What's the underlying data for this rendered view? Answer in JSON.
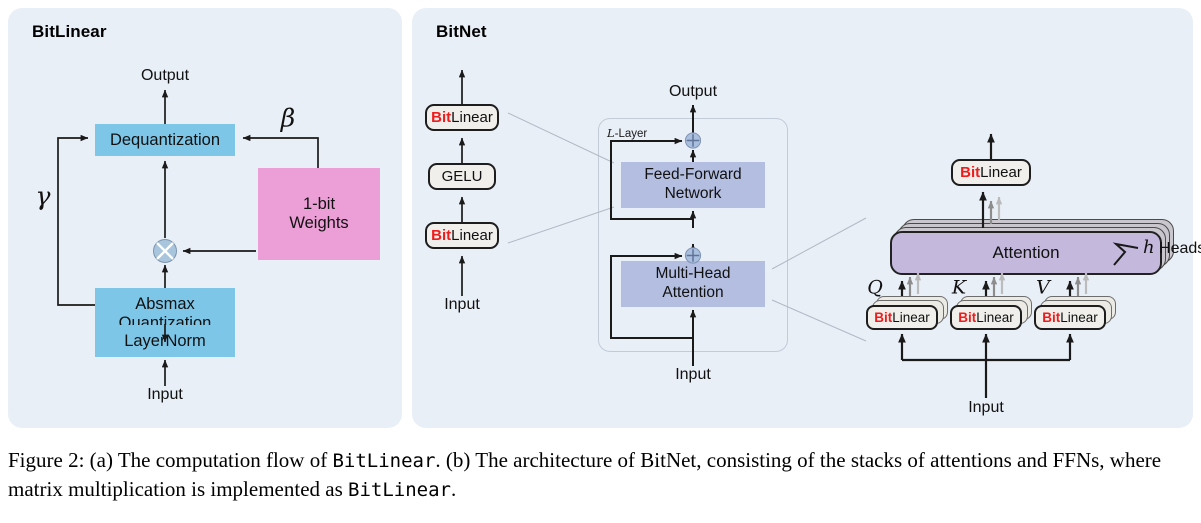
{
  "figure": {
    "caption_part1": "Figure 2: (a) The computation flow of ",
    "caption_mono1": "BitLinear",
    "caption_part2": ". (b) The architecture of BitNet, consisting of the stacks of attentions and FFNs, where matrix multiplication is implemented as ",
    "caption_mono2": "BitLinear",
    "caption_part3": "."
  },
  "colors": {
    "panel_bg": "#e9eff7",
    "blue_block": "#7ec6e8",
    "pink_block": "#eb9fd6",
    "violet_block": "#b3bee0",
    "purple_attention": "#c4b9dd",
    "pill_bg": "#f0efeb",
    "bit_red": "#ee1c1c",
    "arrow": "#1a1a1a",
    "plus_circle": "#a9bede"
  },
  "panel_a": {
    "title": "BitLinear",
    "output_label": "Output",
    "input_label": "Input",
    "blocks": [
      {
        "id": "dequantization",
        "label": "Dequantization",
        "color": "blue"
      },
      {
        "id": "absmax-quantization",
        "label": "Absmax\nQuantization",
        "color": "blue"
      },
      {
        "id": "layernorm",
        "label": "LayerNorm",
        "color": "blue"
      },
      {
        "id": "one-bit-weights",
        "label": "1-bit\nWeights",
        "color": "pink"
      }
    ],
    "one_bit_weights_line1": "1-bit",
    "one_bit_weights_line2": "Weights",
    "absmax_line1": "Absmax",
    "absmax_line2": "Quantization",
    "beta_symbol": "β",
    "gamma_symbol": "γ",
    "multiply_symbol": "⊗"
  },
  "panel_b": {
    "title": "BitNet",
    "sublayer_stack": {
      "input_label": "Input",
      "items": [
        {
          "id": "bitlinear-top",
          "type": "bitlinear",
          "prefix": "Bit",
          "suffix": "Linear"
        },
        {
          "id": "gelu",
          "type": "plain",
          "label": "GELU"
        },
        {
          "id": "bitlinear-bottom",
          "type": "bitlinear",
          "prefix": "Bit",
          "suffix": "Linear"
        }
      ]
    },
    "transformer": {
      "output_label": "Output",
      "input_label": "Input",
      "layer_label_italic": "L",
      "layer_label_rest": "-Layer",
      "ffn_line1": "Feed-Forward",
      "ffn_line2": "Network",
      "mha_line1": "Multi-Head",
      "mha_line2": "Attention",
      "residual_symbol": "⊕"
    },
    "attention_detail": {
      "input_label": "Input",
      "attention_label": "Attention",
      "heads_italic": "h",
      "heads_rest": " Heads",
      "output_projection": {
        "prefix": "Bit",
        "suffix": "Linear"
      },
      "qkv": [
        {
          "id": "q",
          "symbol": "Q",
          "prefix": "Bit",
          "suffix": "Linear"
        },
        {
          "id": "k",
          "symbol": "K",
          "prefix": "Bit",
          "suffix": "Linear"
        },
        {
          "id": "v",
          "symbol": "V",
          "prefix": "Bit",
          "suffix": "Linear"
        }
      ]
    }
  }
}
